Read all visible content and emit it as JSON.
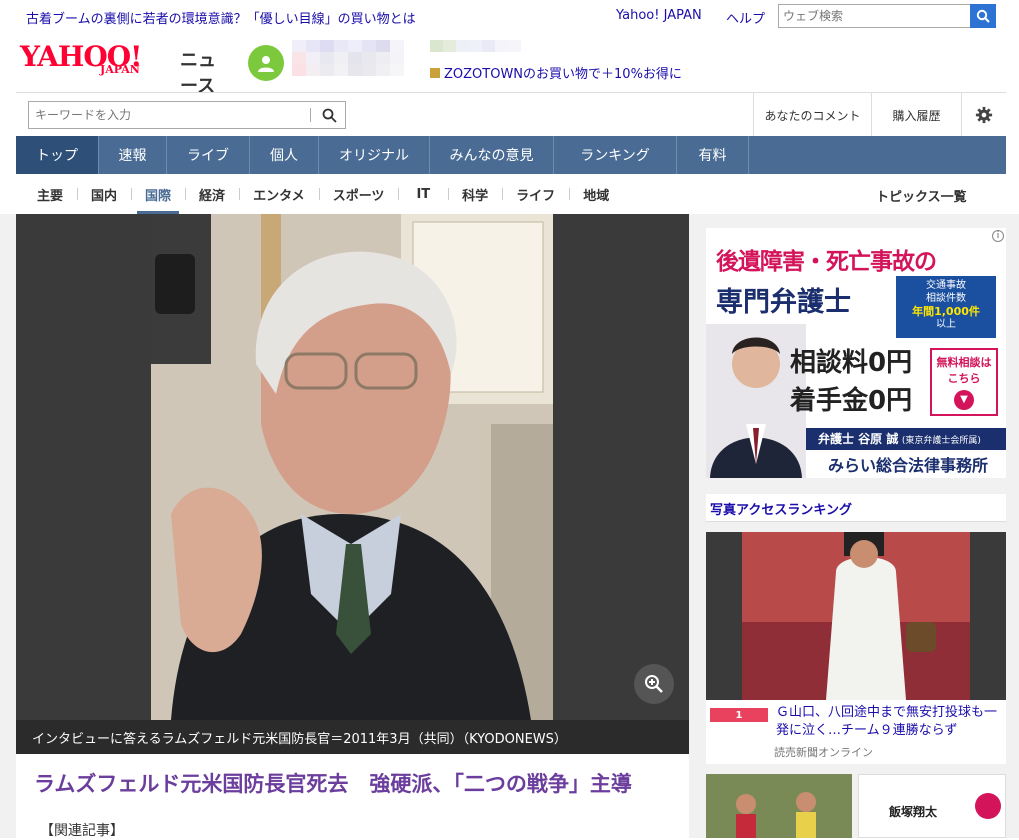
{
  "topbar": {
    "promo": "古着ブームの裏側に若者の環境意識？「優しい目線」の買い物とは",
    "yahoo_japan": "Yahoo! JAPAN",
    "help": "ヘルプ",
    "web_search_placeholder": "ウェブ検索"
  },
  "header": {
    "logo_main": "YAHOO!",
    "logo_sub": "JAPAN",
    "logo_news": "ニュース",
    "zozo_promo": "ZOZOTOWNのお買い物で＋10%お得に"
  },
  "search": {
    "placeholder": "キーワードを入力",
    "my_comments": "あなたのコメント",
    "purchase_history": "購入履歴"
  },
  "global_nav": [
    "トップ",
    "速報",
    "ライブ",
    "個人",
    "オリジナル",
    "みんなの意見",
    "ランキング",
    "有料"
  ],
  "sub_nav": [
    "主要",
    "国内",
    "国際",
    "経済",
    "エンタメ",
    "スポーツ",
    "IT",
    "科学",
    "ライフ",
    "地域"
  ],
  "sub_nav_active": "国際",
  "topics_list": "トピックス一覧",
  "article": {
    "photo_caption": "インタビューに答えるラムズフェルド元米国防長官＝2011年3月（共同）（KYODONEWS）",
    "title": "ラムズフェルド元米国防長官死去　強硬派、「二つの戦争」主導",
    "related": "【関連記事】"
  },
  "ad": {
    "headline": "後遺障害・死亡事故の",
    "subhead": "専門弁護士",
    "badge_line1": "交通事故",
    "badge_line2": "相談件数",
    "badge_line3": "年間1,000件",
    "badge_line4": "以上",
    "fee1": "相談料0円",
    "fee2": "着手金0円",
    "cta": "無料相談はこちら",
    "lawyer": "弁護士 谷原 誠",
    "lawyer_affil": "(東京弁護士会所属)",
    "firm": "みらい総合法律事務所"
  },
  "sidebar": {
    "ranking_title": "写真アクセスランキング",
    "rank1_num": "1",
    "rank1_title": "Ｇ山口、八回途中まで無安打投球も一発に泣く…チーム９連勝ならず",
    "rank1_source": "読売新聞オンライン",
    "thumb2_text": "飯塚翔太"
  }
}
